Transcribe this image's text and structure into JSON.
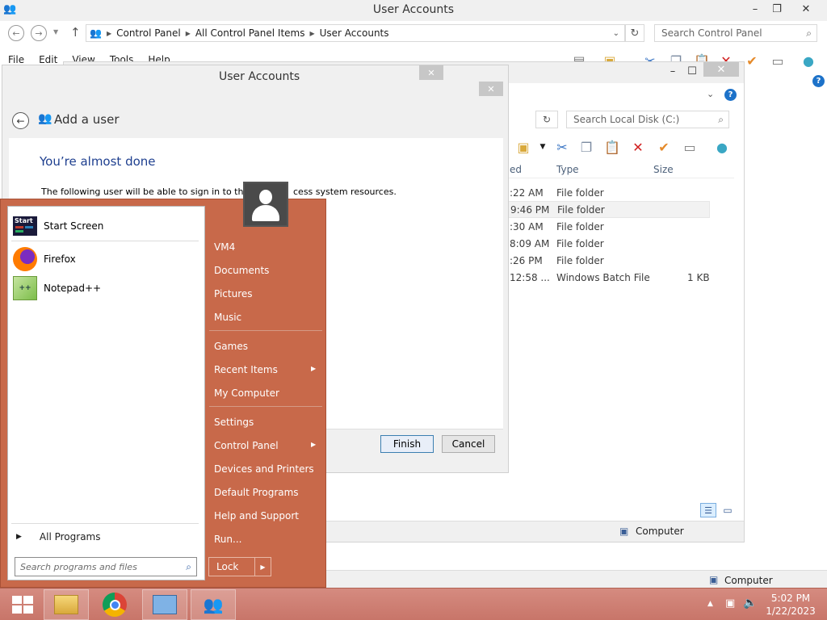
{
  "cp_window": {
    "title": "User Accounts",
    "breadcrumb": [
      "Control Panel",
      "All Control Panel Items",
      "User Accounts"
    ],
    "search_placeholder": "Search Control Panel",
    "menu": [
      "File",
      "Edit",
      "View",
      "Tools",
      "Help"
    ]
  },
  "explorer": {
    "title_fragment": ":)",
    "search_placeholder": "Search Local Disk (C:)",
    "columns": [
      "ed",
      "Type",
      "Size"
    ],
    "rows": [
      {
        "date": ":22 AM",
        "type": "File folder",
        "size": ""
      },
      {
        "date": "9:46 PM",
        "type": "File folder",
        "size": ""
      },
      {
        "date": ":30 AM",
        "type": "File folder",
        "size": ""
      },
      {
        "date": "8:09 AM",
        "type": "File folder",
        "size": ""
      },
      {
        "date": ":26 PM",
        "type": "File folder",
        "size": ""
      },
      {
        "date": "12:58 ...",
        "type": "Windows Batch File",
        "size": "1 KB"
      }
    ],
    "status_computer": "Computer"
  },
  "dialog": {
    "title": "User Accounts",
    "nav_title": "Add a user",
    "heading": "You’re almost done",
    "body_start": "The following user will be able to sign in to this",
    "body_end": "cess system resources.",
    "finish": "Finish",
    "cancel": "Cancel"
  },
  "start_menu": {
    "pinned": [
      {
        "label": "Start Screen",
        "icon": "start-screen-icon"
      },
      {
        "label": "Firefox",
        "icon": "firefox-icon"
      },
      {
        "label": "Notepad++",
        "icon": "notepadpp-icon"
      }
    ],
    "start_tile_text": "Start",
    "all_programs": "All Programs",
    "search_placeholder": "Search programs and files",
    "right_group1": [
      "VM4",
      "Documents",
      "Pictures",
      "Music"
    ],
    "right_group2": [
      "Games",
      "Recent Items",
      "My Computer"
    ],
    "right_group3": [
      "Settings",
      "Control Panel",
      "Devices and Printers",
      "Default Programs",
      "Help and Support",
      "Run..."
    ],
    "lock": "Lock"
  },
  "bottom_status": {
    "computer": "Computer"
  },
  "taskbar": {
    "time": "5:02 PM",
    "date": "1/22/2023"
  },
  "colors": {
    "start_accent": "#c8694a",
    "link_blue": "#1e3f8f",
    "taskbar": "#c87569"
  }
}
